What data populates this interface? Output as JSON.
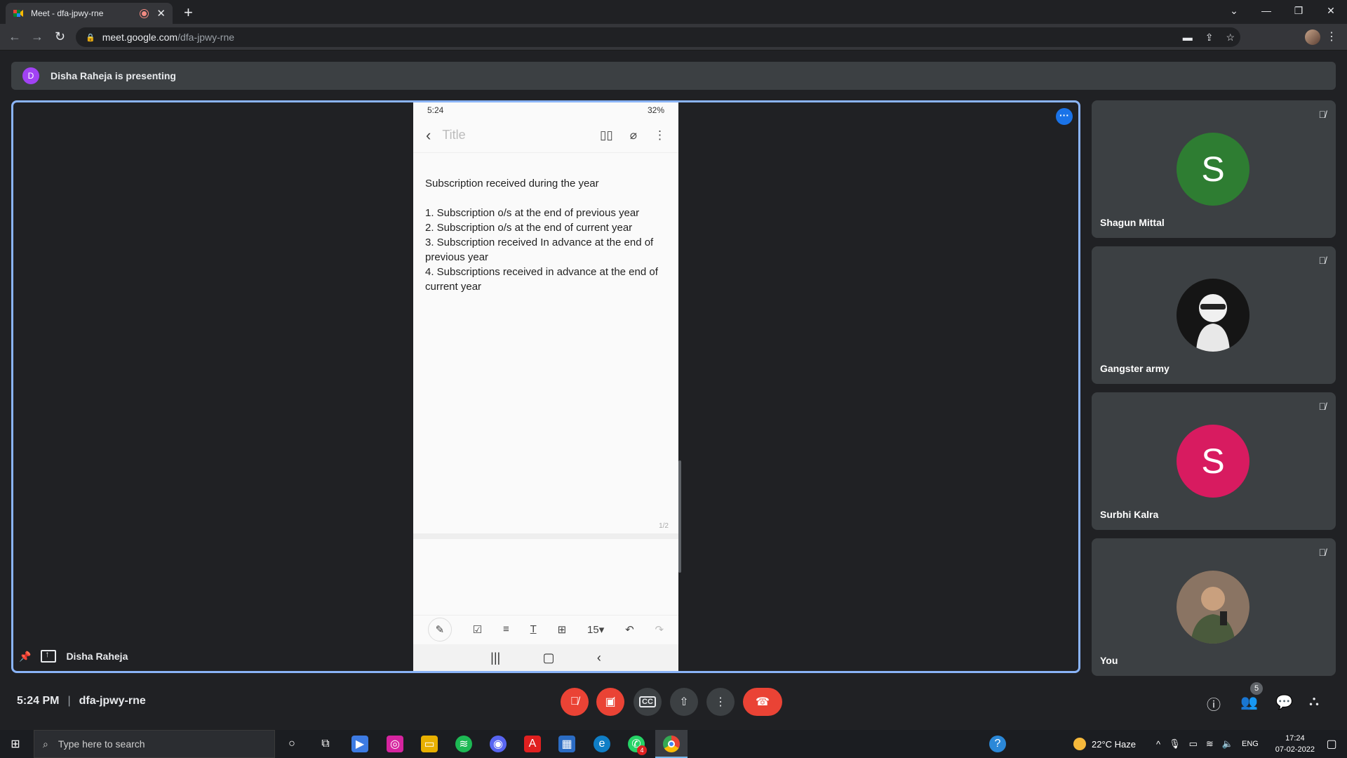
{
  "browser": {
    "tab_title": "Meet - dfa-jpwy-rne",
    "url_host": "meet.google.com",
    "url_path": "/dfa-jpwy-rne"
  },
  "banner": {
    "avatar_letter": "D",
    "text": "Disha Raheja is presenting"
  },
  "stage": {
    "presenter_name": "Disha Raheja",
    "phone": {
      "status_time": "5:24",
      "status_battery": "32%",
      "title_placeholder": "Title",
      "note_heading": "Subscription received during the year",
      "note_lines": [
        "1. Subscription o/s at the end of previous year",
        "2. Subscription o/s at the end of current year",
        "3. Subscription received In advance at the end of previous year",
        "4. Subscriptions received in advance at the end of current year"
      ],
      "page_indicator": "1/2",
      "font_size": "15"
    }
  },
  "participants": [
    {
      "name": "Shagun Mittal",
      "letter": "S",
      "color": "#2e7d32"
    },
    {
      "name": "Gangster army",
      "letter": "",
      "color": "#1a1a1a"
    },
    {
      "name": "Surbhi Kalra",
      "letter": "S",
      "color": "#d81b60"
    },
    {
      "name": "You",
      "letter": "",
      "color": "#6d5a48"
    }
  ],
  "controls": {
    "time": "5:24 PM",
    "meeting_code": "dfa-jpwy-rne",
    "people_count": "5"
  },
  "taskbar": {
    "search_placeholder": "Type here to search",
    "weather": "22°C  Haze",
    "language": "ENG",
    "clock_time": "17:24",
    "clock_date": "07-02-2022",
    "whatsapp_badge": "4"
  },
  "colors": {
    "accent_blue": "#8ab4f8",
    "end_call_red": "#ea4335"
  }
}
